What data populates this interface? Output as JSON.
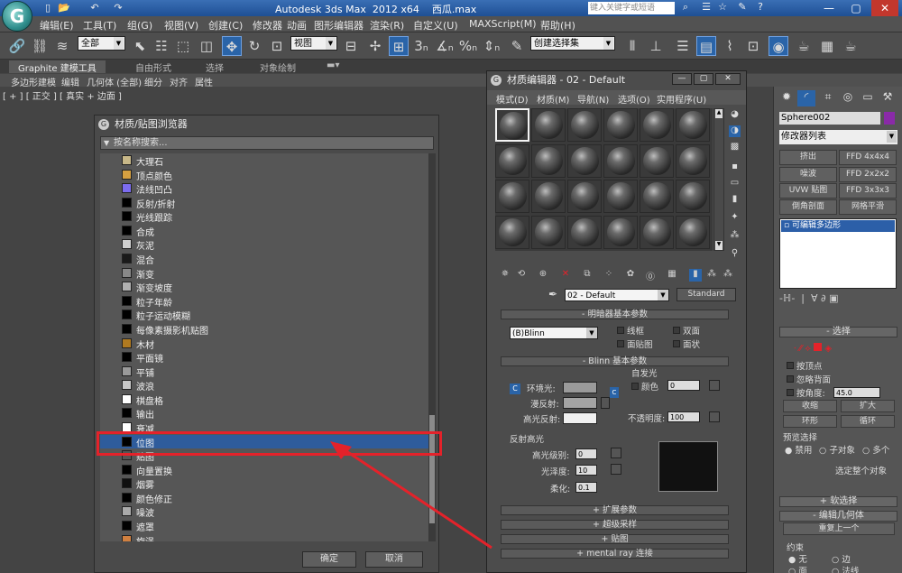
{
  "app": {
    "title": "Autodesk 3ds Max  2012 x64    西瓜.max",
    "search_placeholder": "键入关键字或短语"
  },
  "menu": [
    "编辑(E)",
    "工具(T)",
    "组(G)",
    "视图(V)",
    "创建(C)",
    "修改器",
    "动画",
    "图形编辑器",
    "渲染(R)",
    "自定义(U)",
    "MAXScript(M)",
    "帮助(H)"
  ],
  "toolbar": {
    "selection_filter": "全部",
    "ref_coord": "视图",
    "named_selection": "创建选择集"
  },
  "ribbon": {
    "tabs": [
      "Graphite 建模工具",
      "自由形式",
      "选择",
      "对象绘制"
    ],
    "subtabs": [
      "多边形建模",
      "编辑",
      "几何体 (全部)",
      "细分",
      "对齐",
      "属性"
    ]
  },
  "viewport": {
    "label": "[ + ] [ 正交 ] [ 真实 + 边面 ]"
  },
  "browser": {
    "title": "材质/贴图浏览器",
    "search_placeholder": "按名称搜索...",
    "items": [
      {
        "label": "大理石",
        "color": "#c8b888"
      },
      {
        "label": "顶点颜色",
        "color": "#d6a040"
      },
      {
        "label": "法线凹凸",
        "color": "#7c6cf0"
      },
      {
        "label": "反射/折射",
        "color": "#000000"
      },
      {
        "label": "光线跟踪",
        "color": "#000000"
      },
      {
        "label": "合成",
        "color": "#000000"
      },
      {
        "label": "灰泥",
        "color": "#d0d0d0"
      },
      {
        "label": "混合",
        "color": "#1a1a1a"
      },
      {
        "label": "渐变",
        "color": "#888888"
      },
      {
        "label": "渐变坡度",
        "color": "#b0b0b0"
      },
      {
        "label": "粒子年龄",
        "color": "#000000"
      },
      {
        "label": "粒子运动模糊",
        "color": "#000000"
      },
      {
        "label": "每像素摄影机贴图",
        "color": "#000000"
      },
      {
        "label": "木材",
        "color": "#b07a20"
      },
      {
        "label": "平面镜",
        "color": "#000000"
      },
      {
        "label": "平铺",
        "color": "#9a9a9a"
      },
      {
        "label": "波浪",
        "color": "#c8c8c8"
      },
      {
        "label": "棋盘格",
        "color": "#ffffff"
      },
      {
        "label": "输出",
        "color": "#000000"
      },
      {
        "label": "衰减",
        "color": "#ffffff"
      },
      {
        "label": "位图",
        "color": "#000000"
      },
      {
        "label": "贴图",
        "color": "#555555"
      },
      {
        "label": "向量置换",
        "color": "#000000"
      },
      {
        "label": "烟雾",
        "color": "#101010"
      },
      {
        "label": "颜色修正",
        "color": "#000000"
      },
      {
        "label": "噪波",
        "color": "#aaaaaa"
      },
      {
        "label": "遮罩",
        "color": "#000000"
      },
      {
        "label": "旋涡",
        "color": "#d08040"
      }
    ],
    "selected_index": 20,
    "ok_label": "确定",
    "cancel_label": "取消"
  },
  "mat_editor": {
    "title": "材质编辑器 - 02 - Default",
    "menu": [
      "模式(D)",
      "材质(M)",
      "导航(N)",
      "选项(O)",
      "实用程序(U)"
    ],
    "material_name": "02 - Default",
    "material_type": "Standard",
    "shader_rollout": "明暗器基本参数",
    "shader": "(B)Blinn",
    "wire_label": "线框",
    "two_sided_label": "双面",
    "facemap_label": "面贴图",
    "faceted_label": "面状",
    "blinn_rollout": "Blinn 基本参数",
    "self_illum_label": "自发光",
    "color_label": "颜色",
    "self_illum_value": "0",
    "ambient_label": "环境光:",
    "diffuse_label": "漫反射:",
    "specular_label": "高光反射:",
    "opacity_label": "不透明度:",
    "opacity_value": "100",
    "spec_highlights_label": "反射高光",
    "spec_level_label": "高光级别:",
    "spec_level_value": "0",
    "gloss_label": "光泽度:",
    "gloss_value": "10",
    "soften_label": "柔化:",
    "soften_value": "0.1",
    "rollouts": [
      "扩展参数",
      "超级采样",
      "贴图",
      "mental ray 连接"
    ]
  },
  "cmd_panel": {
    "object_name": "Sphere002",
    "object_color": "#8a2aa8",
    "modifier_list": "修改器列表",
    "mod_buttons": [
      "挤出",
      "FFD 4x4x4",
      "噪波",
      "FFD 2x2x2",
      "UVW 贴图",
      "FFD 3x3x3",
      "倒角剖面",
      "网格平滑"
    ],
    "stack_item": "可编辑多边形",
    "selection_rollout": "选择",
    "by_vertex": "按顶点",
    "ignore_backface": "忽略背面",
    "by_angle": "按角度:",
    "angle_value": "45.0",
    "shrink": "收缩",
    "grow": "扩大",
    "ring": "环形",
    "loop": "循环",
    "preview_selection": "预览选择",
    "disabled": "禁用",
    "subobject": "子对象",
    "multi": "多个",
    "select_whole": "选定整个对象",
    "soft_selection": "软选择",
    "edit_geometry": "编辑几何体",
    "repeat_last": "重复上一个",
    "constraints": "约束",
    "none": "无",
    "edge": "边",
    "face": "面",
    "normal": "法线"
  }
}
